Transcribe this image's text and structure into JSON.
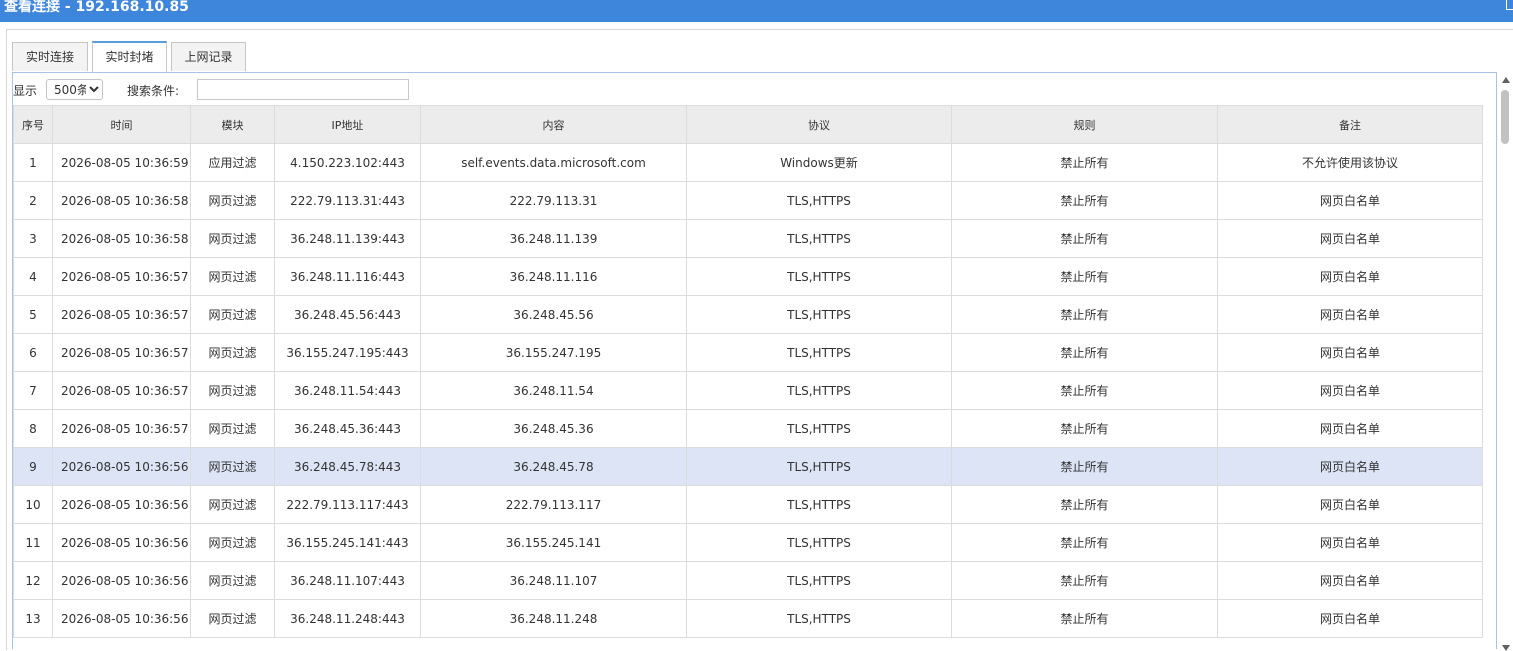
{
  "window": {
    "title": "查看连接 - 192.168.10.85"
  },
  "tabs": [
    {
      "label": "实时连接"
    },
    {
      "label": "实时封堵"
    },
    {
      "label": "上网记录"
    }
  ],
  "toolbar": {
    "show_label": "显示",
    "page_size_selected": "500条",
    "search_label": "搜索条件:",
    "search_value": ""
  },
  "table": {
    "columns": [
      "序号",
      "时间",
      "模块",
      "IP地址",
      "内容",
      "协议",
      "规则",
      "备注"
    ],
    "selected_row": 9,
    "rows": [
      [
        "1",
        "2026-08-05  10:36:59",
        "应用过滤",
        "4.150.223.102:443",
        "self.events.data.microsoft.com",
        "Windows更新",
        "禁止所有",
        "不允许使用该协议"
      ],
      [
        "2",
        "2026-08-05  10:36:58",
        "网页过滤",
        "222.79.113.31:443",
        "222.79.113.31",
        "TLS,HTTPS",
        "禁止所有",
        "网页白名单"
      ],
      [
        "3",
        "2026-08-05  10:36:58",
        "网页过滤",
        "36.248.11.139:443",
        "36.248.11.139",
        "TLS,HTTPS",
        "禁止所有",
        "网页白名单"
      ],
      [
        "4",
        "2026-08-05  10:36:57",
        "网页过滤",
        "36.248.11.116:443",
        "36.248.11.116",
        "TLS,HTTPS",
        "禁止所有",
        "网页白名单"
      ],
      [
        "5",
        "2026-08-05  10:36:57",
        "网页过滤",
        "36.248.45.56:443",
        "36.248.45.56",
        "TLS,HTTPS",
        "禁止所有",
        "网页白名单"
      ],
      [
        "6",
        "2026-08-05  10:36:57",
        "网页过滤",
        "36.155.247.195:443",
        "36.155.247.195",
        "TLS,HTTPS",
        "禁止所有",
        "网页白名单"
      ],
      [
        "7",
        "2026-08-05  10:36:57",
        "网页过滤",
        "36.248.11.54:443",
        "36.248.11.54",
        "TLS,HTTPS",
        "禁止所有",
        "网页白名单"
      ],
      [
        "8",
        "2026-08-05  10:36:57",
        "网页过滤",
        "36.248.45.36:443",
        "36.248.45.36",
        "TLS,HTTPS",
        "禁止所有",
        "网页白名单"
      ],
      [
        "9",
        "2026-08-05  10:36:56",
        "网页过滤",
        "36.248.45.78:443",
        "36.248.45.78",
        "TLS,HTTPS",
        "禁止所有",
        "网页白名单"
      ],
      [
        "10",
        "2026-08-05  10:36:56",
        "网页过滤",
        "222.79.113.117:443",
        "222.79.113.117",
        "TLS,HTTPS",
        "禁止所有",
        "网页白名单"
      ],
      [
        "11",
        "2026-08-05  10:36:56",
        "网页过滤",
        "36.155.245.141:443",
        "36.155.245.141",
        "TLS,HTTPS",
        "禁止所有",
        "网页白名单"
      ],
      [
        "12",
        "2026-08-05  10:36:56",
        "网页过滤",
        "36.248.11.107:443",
        "36.248.11.107",
        "TLS,HTTPS",
        "禁止所有",
        "网页白名单"
      ],
      [
        "13",
        "2026-08-05  10:36:56",
        "网页过滤",
        "36.248.11.248:443",
        "36.248.11.248",
        "TLS,HTTPS",
        "禁止所有",
        "网页白名单"
      ]
    ]
  }
}
